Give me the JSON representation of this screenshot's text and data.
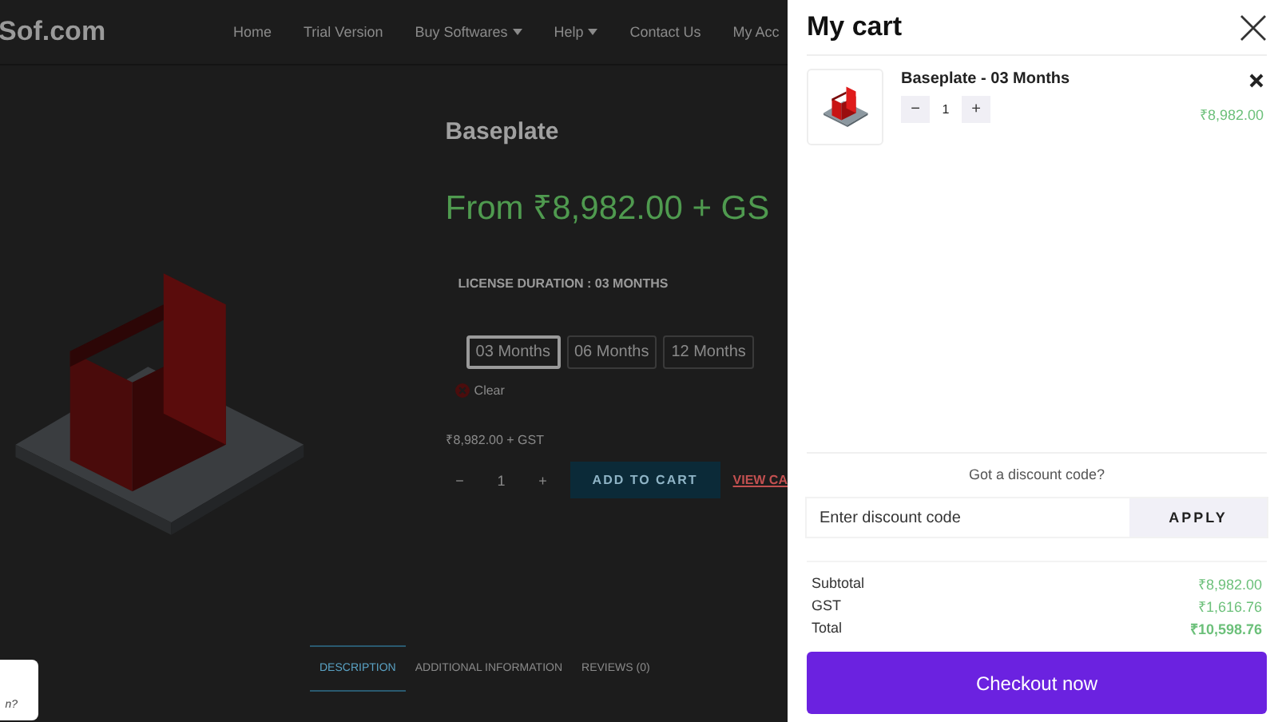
{
  "site": {
    "logo": "Sof.com",
    "nav": [
      {
        "label": "Home",
        "dropdown": false
      },
      {
        "label": "Trial Version",
        "dropdown": false
      },
      {
        "label": "Buy Softwares",
        "dropdown": true
      },
      {
        "label": "Help",
        "dropdown": true
      },
      {
        "label": "Contact Us",
        "dropdown": false
      },
      {
        "label": "My Acc",
        "dropdown": false
      }
    ]
  },
  "product": {
    "title": "Baseplate",
    "price": "From ₹8,982.00 + GS",
    "license_label": "LICENSE DURATION : 03 MONTHS",
    "durations": [
      {
        "label": "03 Months",
        "selected": true
      },
      {
        "label": "06 Months",
        "selected": false
      },
      {
        "label": "12 Months",
        "selected": false
      }
    ],
    "clear": "Clear",
    "price_note": "₹8,982.00 + GST",
    "quantity": "1",
    "decrement": "−",
    "increment": "+",
    "add_to_cart": "ADD TO CART",
    "view_cart": "VIEW CA"
  },
  "tabs": [
    {
      "label": "DESCRIPTION",
      "selected": true
    },
    {
      "label": "ADDITIONAL INFORMATION",
      "selected": false
    },
    {
      "label": "REVIEWS (0)",
      "selected": false
    }
  ],
  "chat_bubble": {
    "text": "n?"
  },
  "cart": {
    "title": "My cart",
    "items": [
      {
        "name": "Baseplate - 03 Months",
        "decrement": "−",
        "quantity": "1",
        "increment": "+",
        "price": "₹8,982.00"
      }
    ],
    "discount": {
      "prompt": "Got a discount code?",
      "placeholder": "Enter discount code",
      "apply": "APPLY"
    },
    "totals": [
      {
        "label": "Subtotal",
        "value": "₹8,982.00",
        "emphasis": false
      },
      {
        "label": "GST",
        "value": "₹1,616.76",
        "emphasis": false
      },
      {
        "label": "Total",
        "value": "₹10,598.76",
        "emphasis": true
      }
    ],
    "checkout": "Checkout now"
  }
}
